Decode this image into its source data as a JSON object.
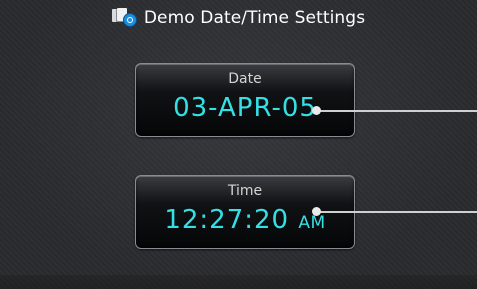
{
  "header": {
    "title": "Demo Date/Time Settings",
    "icon": "date-time-settings-icon"
  },
  "date_field": {
    "label": "Date",
    "value": "03-APR-05"
  },
  "time_field": {
    "label": "Time",
    "value": "12:27:20",
    "suffix": "AM"
  },
  "colors": {
    "value_text": "#34e0e6",
    "label_text": "#d4d4d4",
    "title_text": "#ffffff",
    "background": "#2a2b2e"
  }
}
